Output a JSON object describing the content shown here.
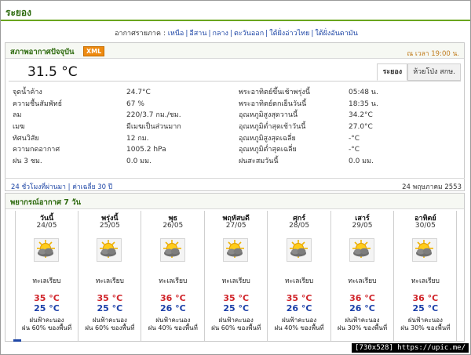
{
  "page": {
    "title": "ระยอง"
  },
  "region_nav": {
    "prefix": "อากาศรายภาค :",
    "links": [
      "เหนือ",
      "อีสาน",
      "กลาง",
      "ตะวันออก",
      "ใต้ฝั่งอ่าวไทย",
      "ใต้ฝั่งอันดามัน"
    ]
  },
  "current": {
    "heading": "สภาพอากาศปัจจุบัน",
    "xml_badge": "XML",
    "time": "ณ เวลา 19:00 น.",
    "temperature": "31.5 °C",
    "tabs": [
      "ระยอง",
      "ห้วยโป่ง สกษ."
    ],
    "active_tab": 0,
    "left_rows": [
      {
        "label": "จุดน้ำค้าง",
        "value": "24.7°C"
      },
      {
        "label": "ความชื้นสัมพัทธ์",
        "value": "67 %"
      },
      {
        "label": "ลม",
        "value": "220/3.7 กม./ชม."
      },
      {
        "label": "เมฆ",
        "value": "มีเมฆเป็นส่วนมาก"
      },
      {
        "label": "ทัศนวิสัย",
        "value": "12 กม."
      },
      {
        "label": "ความกดอากาศ",
        "value": "1005.2 hPa"
      },
      {
        "label": "ฝน 3 ชม.",
        "value": "0.0 มม."
      }
    ],
    "right_rows": [
      {
        "label": "พระอาทิตย์ขึ้นเช้าพรุ่งนี้",
        "value": "05:48 น."
      },
      {
        "label": "พระอาทิตย์ตกเย็นวันนี้",
        "value": "18:35 น."
      },
      {
        "label": "อุณหภูมิสูงสุดวานนี้",
        "value": "34.2°C"
      },
      {
        "label": "อุณหภูมิต่ำสุดเช้าวันนี้",
        "value": "27.0°C"
      },
      {
        "label": "อุณหภูมิสูงสุดเฉลี่ย",
        "value": "-°C"
      },
      {
        "label": "อุณหภูมิต่ำสุดเฉลี่ย",
        "value": "-°C"
      },
      {
        "label": "ฝนสะสมวันนี้",
        "value": "0.0 มม."
      }
    ],
    "history_links": [
      "24 ชั่วโมงที่ผ่านมา",
      "ค่าเฉลี่ย 30 ปี"
    ],
    "date": "24 พฤษภาคม 2553"
  },
  "forecast": {
    "heading": "พยากรณ์อากาศ 7 วัน",
    "days": [
      {
        "name": "วันนี้",
        "date": "24/05",
        "icon": "partly-cloudy-sun-icon",
        "cond": "ทะเลเรียบ",
        "hi": "35 °C",
        "lo": "25 °C",
        "rain": "ฝนฟ้าคะนอง",
        "rainp": "ฝน 60% ของพื้นที่"
      },
      {
        "name": "พรุ่งนี้",
        "date": "25/05",
        "icon": "partly-cloudy-sun-icon",
        "cond": "ทะเลเรียบ",
        "hi": "35 °C",
        "lo": "25 °C",
        "rain": "ฝนฟ้าคะนอง",
        "rainp": "ฝน 60% ของพื้นที่"
      },
      {
        "name": "พุธ",
        "date": "26/05",
        "icon": "partly-cloudy-sun-icon",
        "cond": "ทะเลเรียบ",
        "hi": "36 °C",
        "lo": "26 °C",
        "rain": "ฝนฟ้าคะนอง",
        "rainp": "ฝน 40% ของพื้นที่"
      },
      {
        "name": "พฤหัสบดี",
        "date": "27/05",
        "icon": "partly-cloudy-sun-icon",
        "cond": "ทะเลเรียบ",
        "hi": "35 °C",
        "lo": "25 °C",
        "rain": "ฝนฟ้าคะนอง",
        "rainp": "ฝน 60% ของพื้นที่"
      },
      {
        "name": "ศุกร์",
        "date": "28/05",
        "icon": "partly-cloudy-sun-icon",
        "cond": "ทะเลเรียบ",
        "hi": "35 °C",
        "lo": "26 °C",
        "rain": "ฝนฟ้าคะนอง",
        "rainp": "ฝน 40% ของพื้นที่"
      },
      {
        "name": "เสาร์",
        "date": "29/05",
        "icon": "partly-cloudy-sun-icon",
        "cond": "ทะเลเรียบ",
        "hi": "36 °C",
        "lo": "26 °C",
        "rain": "ฝนฟ้าคะนอง",
        "rainp": "ฝน 30% ของพื้นที่"
      },
      {
        "name": "อาทิตย์",
        "date": "30/05",
        "icon": "partly-cloudy-sun-icon",
        "cond": "ทะเลเรียบ",
        "hi": "36 °C",
        "lo": "25 °C",
        "rain": "ฝนฟ้าคะนอง",
        "rainp": "ฝน 30% ของพื้นที่"
      }
    ]
  },
  "watermark": "[730x528] https://upic.me/",
  "colors": {
    "accent_green": "#2e6b0f",
    "link_blue": "#1f47a6",
    "hi_red": "#d0242a",
    "lo_blue": "#1b3fa8",
    "xml_orange": "#ee8a10"
  }
}
